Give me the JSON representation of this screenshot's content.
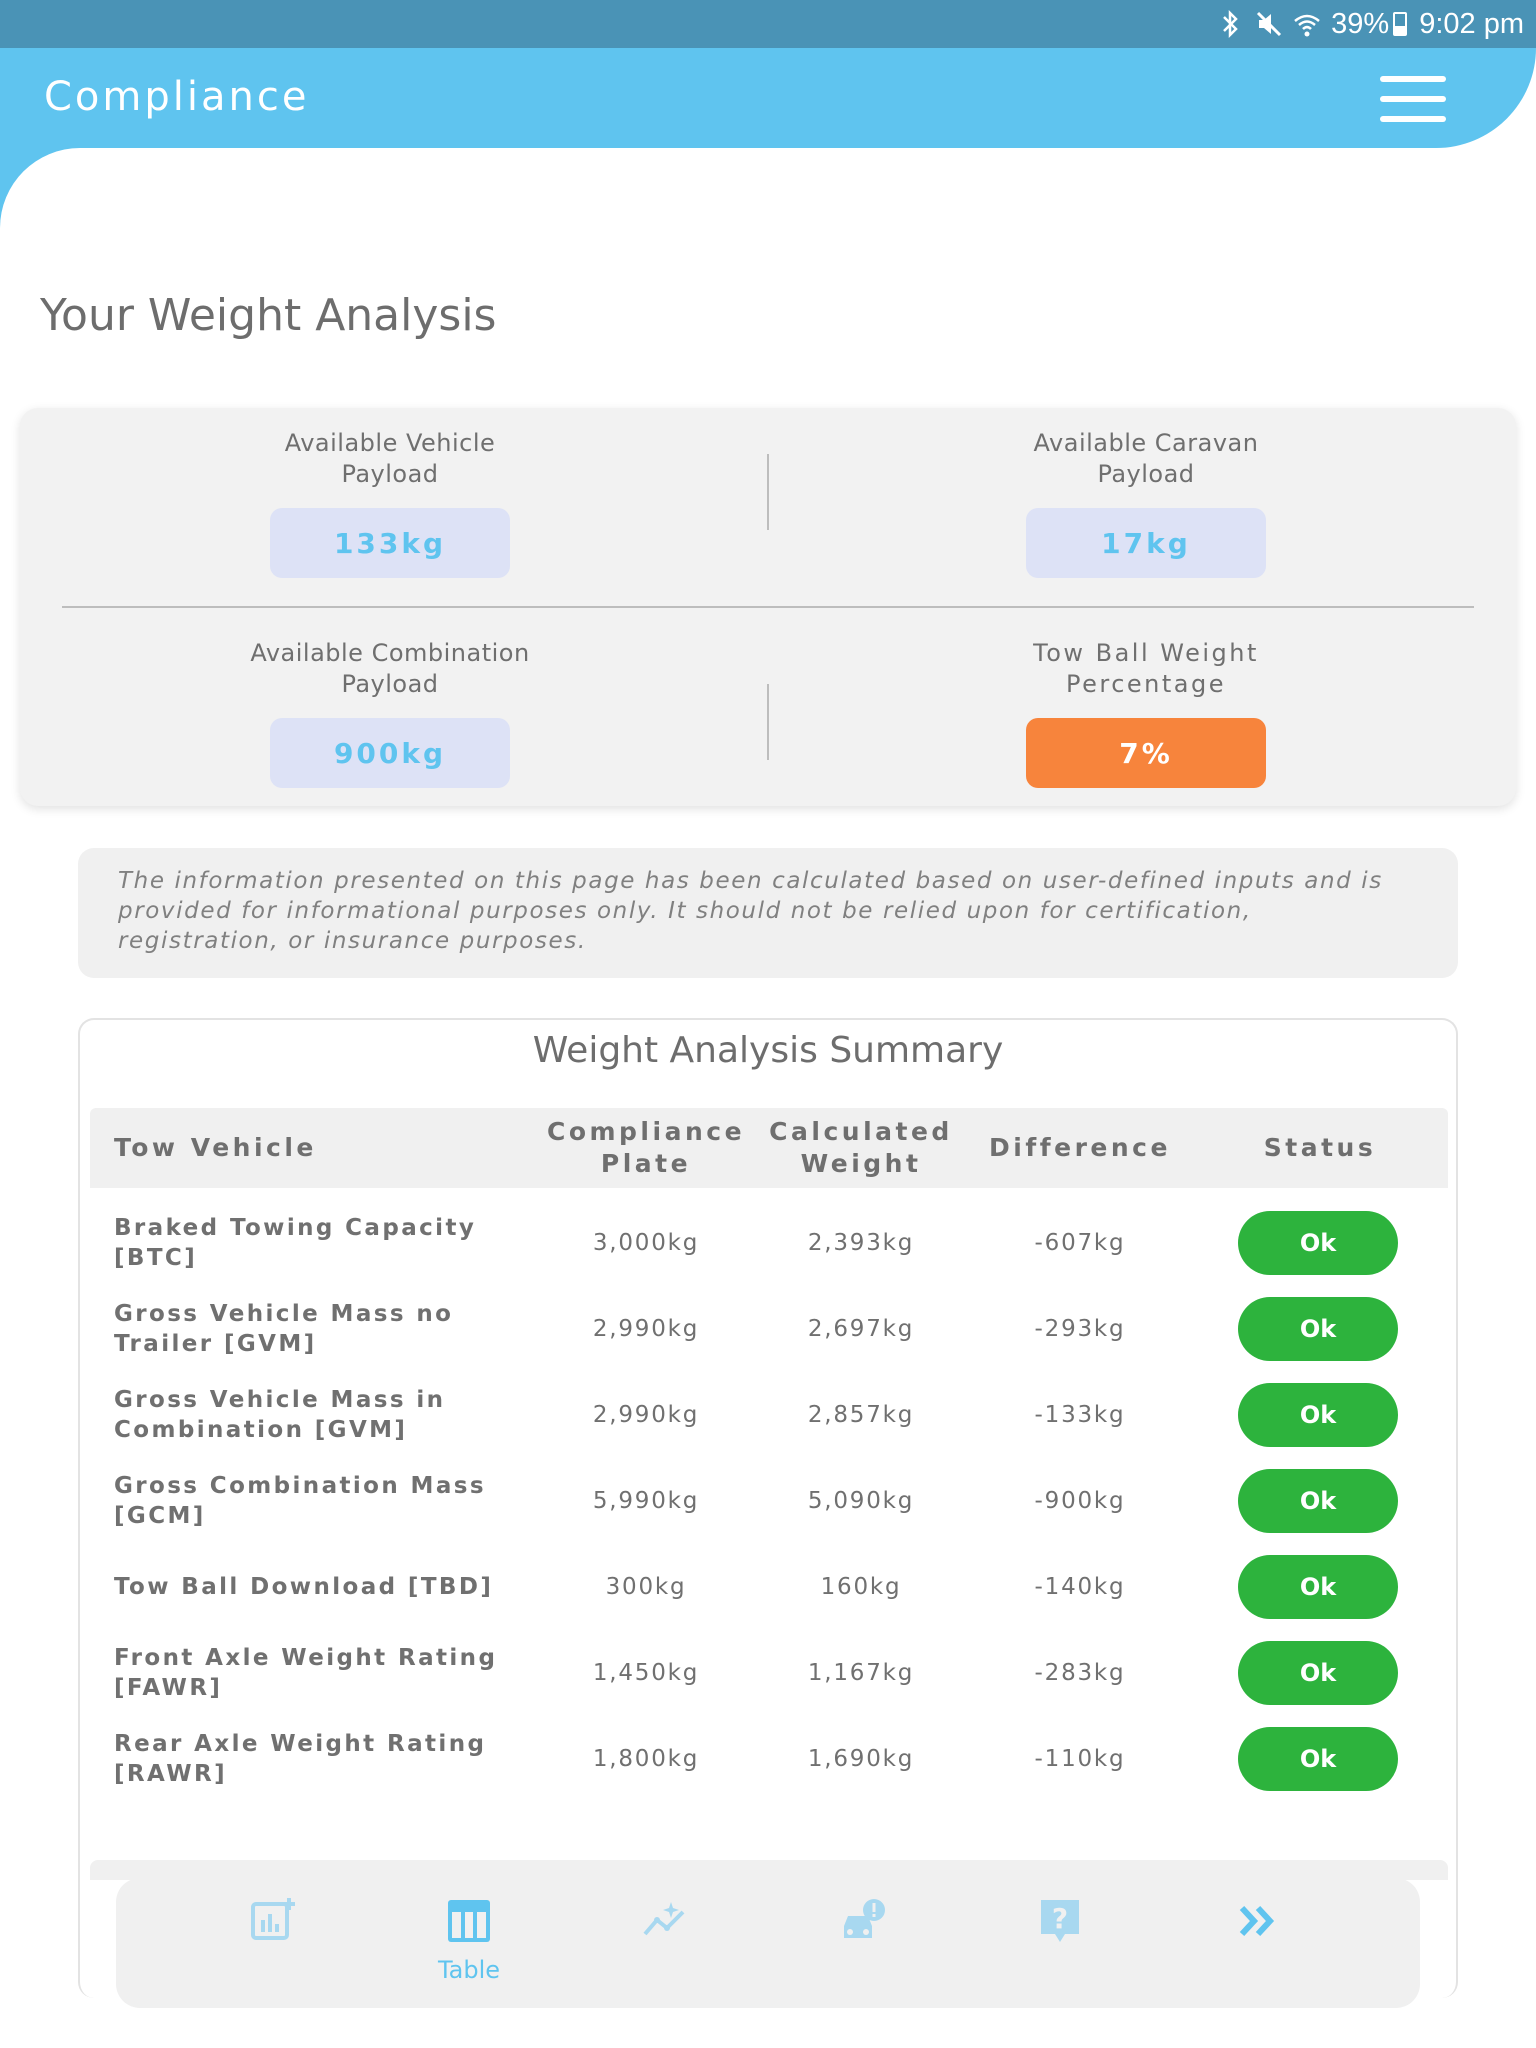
{
  "status_bar": {
    "battery": "39%",
    "time": "9:02 pm"
  },
  "header": {
    "title": "Compliance"
  },
  "page": {
    "title": "Your Weight Analysis"
  },
  "payload_summary": {
    "vehicle": {
      "label": "Available Vehicle Payload",
      "value": "133kg"
    },
    "caravan": {
      "label": "Available Caravan Payload",
      "value": "17kg"
    },
    "combination": {
      "label": "Available Combination Payload",
      "value": "900kg"
    },
    "tow_ball": {
      "label": "Tow Ball Weight Percentage",
      "value": "7%"
    }
  },
  "disclaimer": "The information presented on this page has been calculated based on user-defined inputs and is provided for informational purposes only. It should not be relied upon for certification, registration, or insurance purposes.",
  "summary": {
    "title": "Weight Analysis Summary",
    "columns": {
      "name": "Tow Vehicle",
      "plate": "Compliance Plate",
      "calculated": "Calculated Weight",
      "difference": "Difference",
      "status": "Status"
    },
    "rows": [
      {
        "name": "Braked Towing Capacity [BTC]",
        "plate": "3,000kg",
        "calculated": "2,393kg",
        "difference": "-607kg",
        "status": "Ok"
      },
      {
        "name": "Gross Vehicle Mass no Trailer [GVM]",
        "plate": "2,990kg",
        "calculated": "2,697kg",
        "difference": "-293kg",
        "status": "Ok"
      },
      {
        "name": "Gross Vehicle Mass in Combination [GVM]",
        "plate": "2,990kg",
        "calculated": "2,857kg",
        "difference": "-133kg",
        "status": "Ok"
      },
      {
        "name": "Gross Combination Mass [GCM]",
        "plate": "5,990kg",
        "calculated": "5,090kg",
        "difference": "-900kg",
        "status": "Ok"
      },
      {
        "name": "Tow Ball Download [TBD]",
        "plate": "300kg",
        "calculated": "160kg",
        "difference": "-140kg",
        "status": "Ok"
      },
      {
        "name": "Front Axle Weight Rating [FAWR]",
        "plate": "1,450kg",
        "calculated": "1,167kg",
        "difference": "-283kg",
        "status": "Ok"
      },
      {
        "name": "Rear Axle Weight Rating [RAWR]",
        "plate": "1,800kg",
        "calculated": "1,690kg",
        "difference": "-110kg",
        "status": "Ok"
      }
    ]
  },
  "bottom_nav": {
    "items": [
      {
        "icon": "add-chart-icon",
        "label": ""
      },
      {
        "icon": "table-icon",
        "label": "Table",
        "active": true
      },
      {
        "icon": "trend-sparkle-icon",
        "label": ""
      },
      {
        "icon": "car-alert-icon",
        "label": ""
      },
      {
        "icon": "help-icon",
        "label": ""
      },
      {
        "icon": "double-chevron-right-icon",
        "label": ""
      }
    ]
  },
  "colors": {
    "header": "#5fc4ef",
    "status_bar": "#4a93b6",
    "ok": "#2db33d",
    "warning": "#f7843c",
    "pill_bg": "#dde2f6"
  }
}
